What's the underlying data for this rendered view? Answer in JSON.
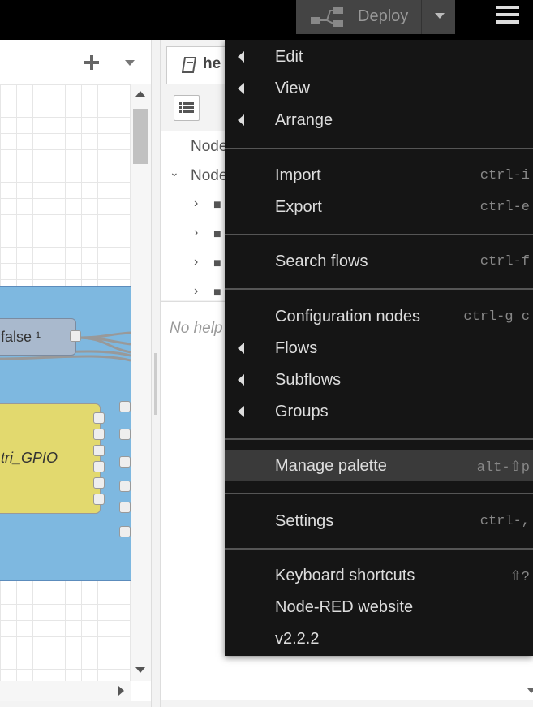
{
  "header": {
    "deploy_label": "Deploy"
  },
  "workspace": {
    "nodes": {
      "false_label": "false ¹",
      "gpio_label": "tri_GPIO"
    }
  },
  "sidebar": {
    "tab_label": "he",
    "tree": {
      "row1": "Node",
      "row2": "Node"
    },
    "help_text": "No help"
  },
  "menu": {
    "items": [
      {
        "label": "Edit",
        "submenu": true
      },
      {
        "label": "View",
        "submenu": true
      },
      {
        "label": "Arrange",
        "submenu": true
      },
      {
        "label": "Import",
        "shortcut": "ctrl-i"
      },
      {
        "label": "Export",
        "shortcut": "ctrl-e"
      },
      {
        "label": "Search flows",
        "shortcut": "ctrl-f"
      },
      {
        "label": "Configuration nodes",
        "shortcut": "ctrl-g c"
      },
      {
        "label": "Flows",
        "submenu": true
      },
      {
        "label": "Subflows",
        "submenu": true
      },
      {
        "label": "Groups",
        "submenu": true
      },
      {
        "label": "Manage palette",
        "shortcut": "alt-⇧p"
      },
      {
        "label": "Settings",
        "shortcut": "ctrl-,"
      },
      {
        "label": "Keyboard shortcuts",
        "shortcut": "⇧?"
      },
      {
        "label": "Node-RED website"
      },
      {
        "label": "v2.2.2"
      }
    ]
  },
  "colors": {
    "menu_bg": "#151515",
    "highlight": "#3a3a3a",
    "group_bg": "#7eb8e0",
    "gpio_node": "#e2d96e"
  }
}
